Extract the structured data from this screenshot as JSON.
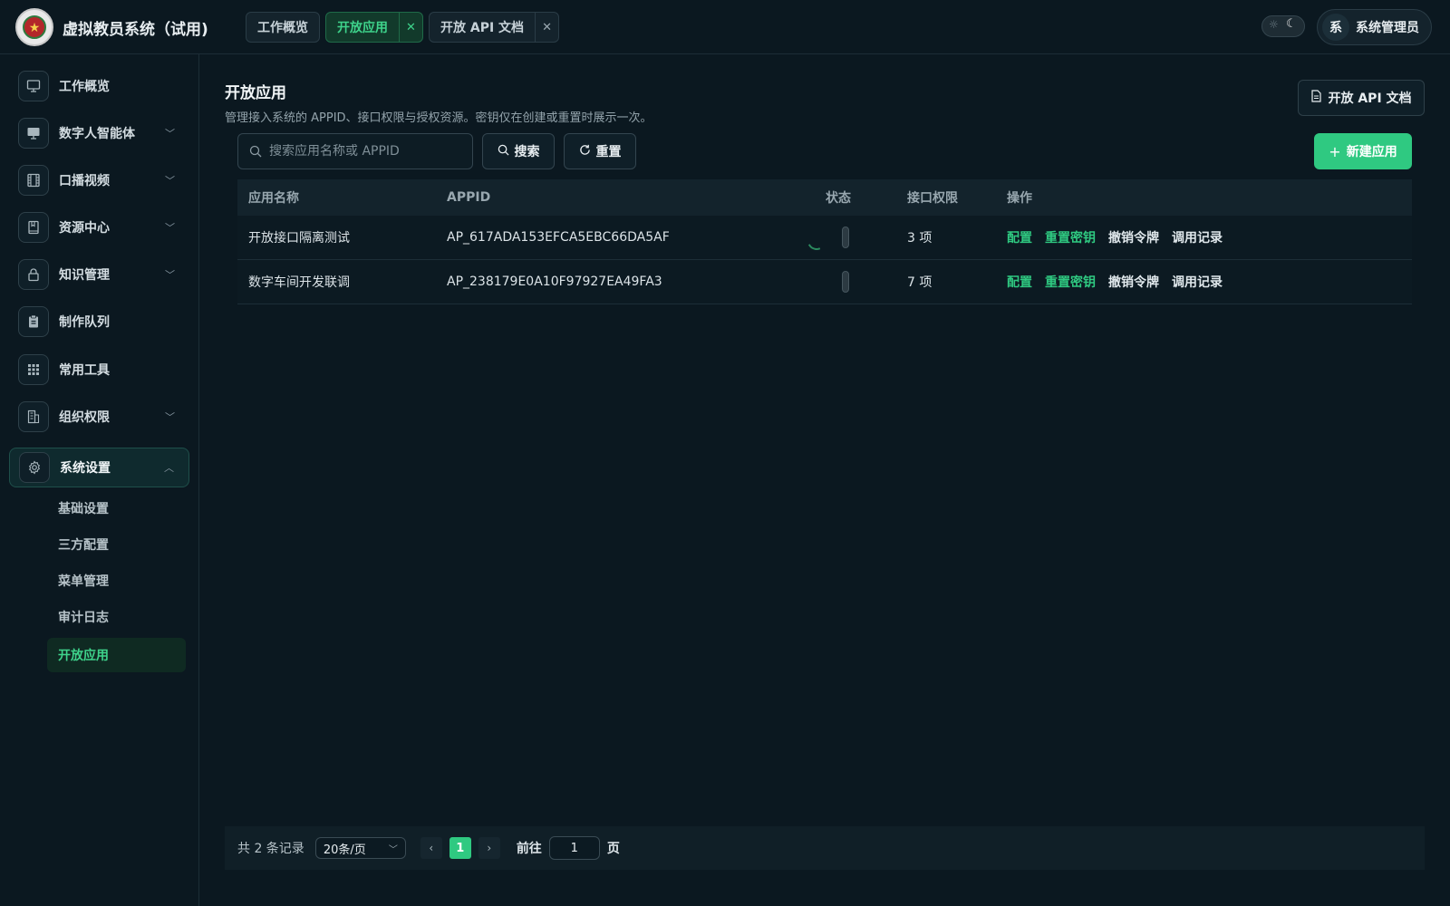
{
  "app": {
    "title": "虚拟教员系统（试用)"
  },
  "tabs": [
    {
      "label": "工作概览",
      "active": false,
      "closable": false
    },
    {
      "label": "开放应用",
      "active": true,
      "closable": true
    },
    {
      "label": "开放 API 文档",
      "active": false,
      "closable": true
    }
  ],
  "user": {
    "avatar_text": "系",
    "name": "系统管理员"
  },
  "icons": {
    "close": "close-icon",
    "theme_sun": "sun-icon",
    "theme_moon": "moon-icon",
    "search": "search-icon",
    "refresh": "refresh-icon",
    "plus": "plus-icon",
    "doc": "document-icon"
  },
  "sidebar": {
    "items": [
      {
        "label": "工作概览",
        "icon": "monitor-icon",
        "expandable": false
      },
      {
        "label": "数字人智能体",
        "icon": "screen-icon",
        "expandable": true
      },
      {
        "label": "口播视频",
        "icon": "film-icon",
        "expandable": true
      },
      {
        "label": "资源中心",
        "icon": "book-icon",
        "expandable": true
      },
      {
        "label": "知识管理",
        "icon": "lock-icon",
        "expandable": true
      },
      {
        "label": "制作队列",
        "icon": "clipboard-icon",
        "expandable": false
      },
      {
        "label": "常用工具",
        "icon": "grid-icon",
        "expandable": false
      },
      {
        "label": "组织权限",
        "icon": "building-icon",
        "expandable": true
      },
      {
        "label": "系统设置",
        "icon": "gear-icon",
        "expandable": true,
        "open": true
      }
    ],
    "sub_items": [
      {
        "label": "基础设置",
        "active": false
      },
      {
        "label": "三方配置",
        "active": false
      },
      {
        "label": "菜单管理",
        "active": false
      },
      {
        "label": "审计日志",
        "active": false
      },
      {
        "label": "开放应用",
        "active": true
      }
    ]
  },
  "main": {
    "title": "开放应用",
    "description": "管理接入系统的 APPID、接口权限与授权资源。密钥仅在创建或重置时展示一次。",
    "api_doc_button": "开放 API 文档",
    "search": {
      "placeholder": "搜索应用名称或 APPID",
      "value": ""
    },
    "search_button": "搜索",
    "reset_button": "重置",
    "new_button": "新建应用"
  },
  "table": {
    "columns": [
      "应用名称",
      "APPID",
      "状态",
      "接口权限",
      "操作"
    ],
    "rows": [
      {
        "name": "开放接口隔离测试",
        "appid": "AP_617ADA153EFCA5EBC66DA5AF",
        "status": "disabled",
        "loading": true,
        "permissions": "3 项"
      },
      {
        "name": "数字车间开发联调",
        "appid": "AP_238179E0A10F97927EA49FA3",
        "status": "disabled",
        "loading": false,
        "permissions": "7 项"
      }
    ],
    "actions": [
      "配置",
      "重置密钥",
      "撤销令牌",
      "调用记录"
    ]
  },
  "pagination": {
    "total_text": "共 2 条记录",
    "page_size": "20条/页",
    "current_page": "1",
    "goto_label": "前往",
    "goto_value": "1",
    "page_unit": "页"
  },
  "colors": {
    "accent": "#2fc981",
    "background": "#0b1820",
    "active_tab_bg": "#123a2b"
  }
}
